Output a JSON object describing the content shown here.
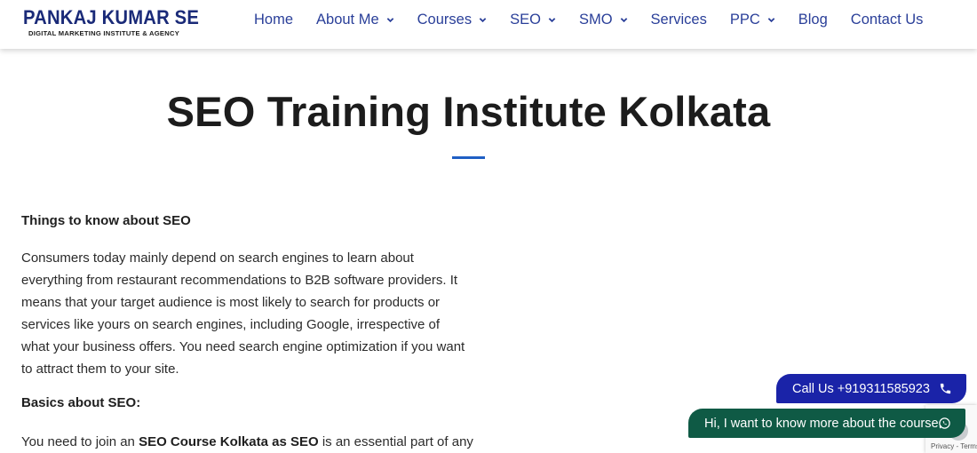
{
  "brand": {
    "name": "PANKAJ KUMAR SE",
    "tagline": "DIGITAL MARKETING INSTITUTE & AGENCY",
    "logo_icon": "target-o-icon",
    "color": "#1a2a78"
  },
  "nav": {
    "items": [
      {
        "label": "Home",
        "has_dropdown": false
      },
      {
        "label": "About Me",
        "has_dropdown": true
      },
      {
        "label": "Courses",
        "has_dropdown": true
      },
      {
        "label": "SEO",
        "has_dropdown": true
      },
      {
        "label": "SMO",
        "has_dropdown": true
      },
      {
        "label": "Services",
        "has_dropdown": false
      },
      {
        "label": "PPC",
        "has_dropdown": true
      },
      {
        "label": "Blog",
        "has_dropdown": false
      },
      {
        "label": "Contact Us",
        "has_dropdown": false
      }
    ],
    "color": "#2a3f99"
  },
  "page": {
    "title": "SEO Training Institute Kolkata",
    "accent": "#1f5fc4"
  },
  "content": {
    "heading_things": "Things to know about SEO",
    "para1": "Consumers today mainly depend on search engines to learn about everything from restaurant recommendations to B2B software providers. It means that your target audience is most likely to search for products or services like yours on search engines, including Google, irrespective of what your business offers. You need search engine optimization if you want to attract them to your site.",
    "heading_basics": "Basics about SEO:",
    "para2_prefix": "You need to join an ",
    "para2_bold": "SEO Course Kolkata as SEO",
    "para2_suffix": " is an essential part of any"
  },
  "cta": {
    "call_label": "Call Us +919311585923",
    "call_icon": "phone-icon",
    "call_color": "#1a23a8",
    "whatsapp_label": "Hi, I want to know more about the course.",
    "whatsapp_icon": "whatsapp-icon",
    "whatsapp_color": "#0f5a45"
  },
  "recaptcha": {
    "text": "Privacy - Terms"
  }
}
